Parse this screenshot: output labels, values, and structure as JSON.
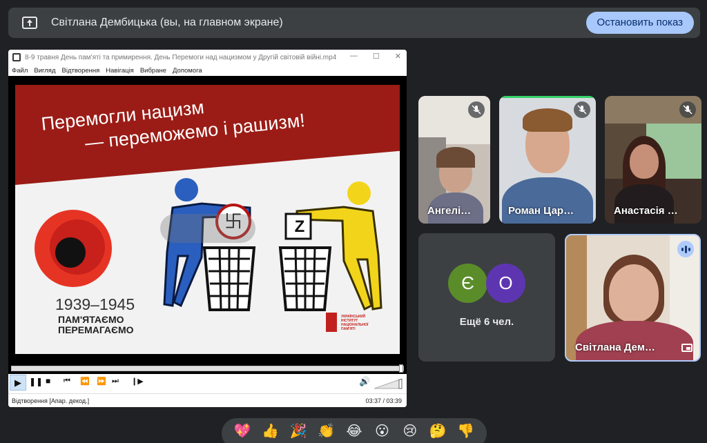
{
  "banner": {
    "text": "Світлана Дембицька (вы, на главном экране)",
    "stop_label": "Остановить показ"
  },
  "player": {
    "title": "8-9 травня День пам'яті та примирення. День Перемоги над нацизмом у Другій світовій війні.mp4",
    "menu": [
      "Файл",
      "Вигляд",
      "Відтворення",
      "Навігація",
      "Вибране",
      "Допомога"
    ],
    "status_left": "Відтворення [Апар. декод.]",
    "status_time": "03:37 / 03:39",
    "progress": 0.99,
    "slide": {
      "title_line1": "Перемогли нацизм",
      "title_line2": "— переможемо і рашизм!",
      "years": "1939–1945",
      "sub_line1": "ПАМ'ЯТАЄМО",
      "sub_line2": "ПЕРЕМАГАЄМО",
      "institute": "УКРАЇНСЬКИЙ ІНСТИТУТ НАЦІОНАЛЬНОЇ ПАМ'ЯТІ",
      "z_letter": "Z"
    }
  },
  "participants": [
    {
      "name": "Ангелі…",
      "muted": true
    },
    {
      "name": "Роман Цар…",
      "muted": true
    },
    {
      "name": "Анастасія …",
      "muted": true
    },
    {
      "name": "Світлана Дем…",
      "muted": false
    }
  ],
  "more": {
    "avatars": [
      {
        "letter": "Є",
        "color": "#5b8c2a"
      },
      {
        "letter": "О",
        "color": "#5e35b1"
      }
    ],
    "text": "Ещё 6 чел."
  },
  "reactions": [
    "💖",
    "👍",
    "🎉",
    "👏",
    "😂",
    "😮",
    "😢",
    "🤔",
    "👎"
  ],
  "colors": {
    "background": "#202124",
    "banner": "#3c4043",
    "accent": "#a8c7fa",
    "active_speaker_border": "#aecbfa"
  }
}
